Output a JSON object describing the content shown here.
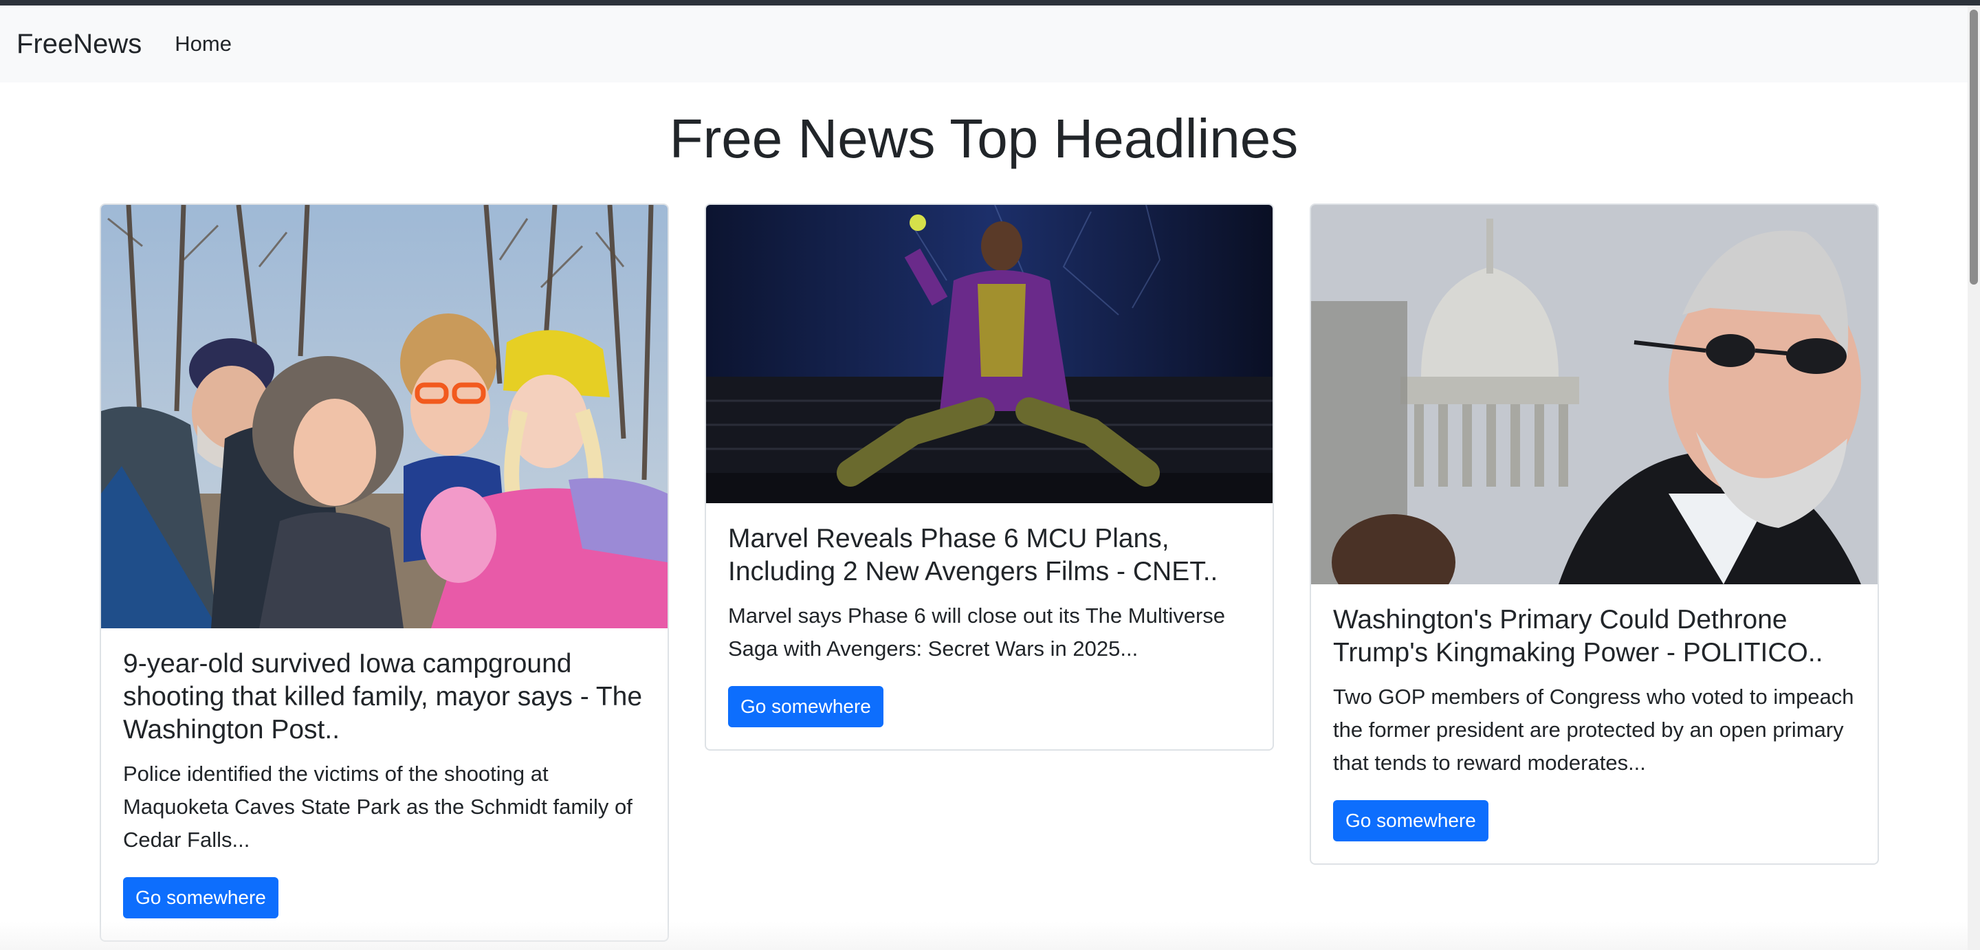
{
  "navbar": {
    "brand": "FreeNews",
    "links": [
      {
        "label": "Home"
      }
    ]
  },
  "page": {
    "title": "Free News Top Headlines"
  },
  "articles": [
    {
      "title": "9-year-old survived Iowa campground shooting that killed family, mayor says - The Washington Post..",
      "description": "Police identified the victims of the shooting at Maquoketa Caves State Park as the Schmidt family of Cedar Falls...",
      "button_label": "Go somewhere",
      "image_subject": "family-selfie-in-woods"
    },
    {
      "title": "Marvel Reveals Phase 6 MCU Plans, Including 2 New Avengers Films - CNET..",
      "description": "Marvel says Phase 6 will close out its The Multiverse Saga with Avengers: Secret Wars in 2025...",
      "button_label": "Go somewhere",
      "image_subject": "man-in-purple-cloak-seated"
    },
    {
      "title": "Washington's Primary Could Dethrone Trump's Kingmaking Power - POLITICO..",
      "description": "Two GOP members of Congress who voted to impeach the former president are protected by an open primary that tends to reward moderates...",
      "button_label": "Go somewhere",
      "image_subject": "man-with-sunglasses-near-capitol"
    }
  ],
  "colors": {
    "primary": "#0d6efd",
    "navbar_bg": "#f8f9fa",
    "text": "#212529"
  }
}
